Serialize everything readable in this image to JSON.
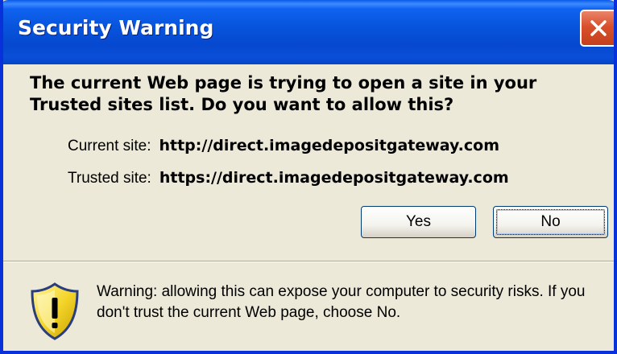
{
  "window": {
    "title": "Security Warning",
    "close_icon": "close-icon",
    "accent_color": "#0831d9",
    "close_color": "#d9502b",
    "background": "#ece9d8"
  },
  "message": {
    "question": "The current Web page is trying to open a site in your Trusted sites list. Do you want to allow this?"
  },
  "sites": {
    "current_label": "Current site:",
    "current_value": "http://direct.imagedepositgateway.com",
    "trusted_label": "Trusted site:",
    "trusted_value": "https://direct.imagedepositgateway.com"
  },
  "buttons": {
    "yes_label": "Yes",
    "no_label": "No",
    "default": "No"
  },
  "footer": {
    "icon": "shield-warning-icon",
    "warning_text": "Warning: allowing this can expose your computer to security risks. If you don't trust the current Web page, choose No."
  }
}
